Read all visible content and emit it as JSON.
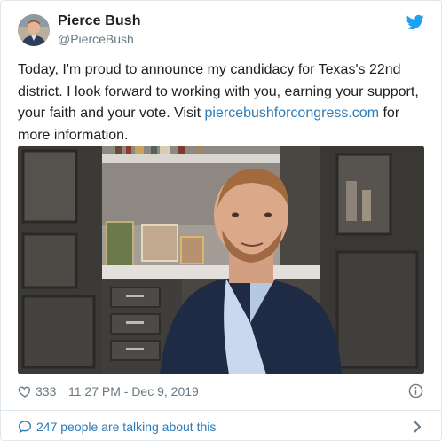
{
  "author": {
    "display_name": "Pierce Bush",
    "handle": "@PierceBush",
    "avatar_icon": "profile-photo"
  },
  "tweet": {
    "text_lines": [
      "Today, I'm proud to announce my candidacy for Texas's 22nd",
      "district. I look forward to working with you, earning your support,",
      "your faith and your vote. Visit "
    ],
    "link_text": "piercebushforcongress.com",
    "text_after_link": " for",
    "last_line": "more information."
  },
  "media": {
    "kind": "video-thumbnail"
  },
  "footer": {
    "like_icon": "heart-icon",
    "likes": "333",
    "timestamp": "11:27 PM - Dec 9, 2019",
    "info_icon": "info-icon"
  },
  "conversation": {
    "icon": "speech-bubble-icon",
    "label": "247 people are talking about this",
    "chevron_icon": "chevron-right-icon"
  },
  "colors": {
    "link": "#2b7bb9",
    "twitter_blue": "#1da1f2",
    "secondary_text": "#697882",
    "border": "#e1e8ed"
  }
}
